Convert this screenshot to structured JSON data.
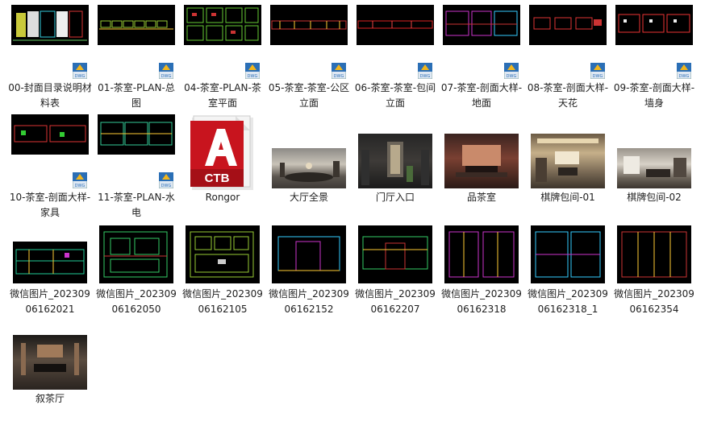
{
  "files": [
    {
      "name": "00-封面目录说明材料表",
      "type": "dwg"
    },
    {
      "name": "01-茶室-PLAN-总图",
      "type": "dwg"
    },
    {
      "name": "04-茶室-PLAN-茶室平面",
      "type": "dwg"
    },
    {
      "name": "05-茶室-茶室-公区立面",
      "type": "dwg"
    },
    {
      "name": "06-茶室-茶室-包间立面",
      "type": "dwg"
    },
    {
      "name": "07-茶室-剖面大样-地面",
      "type": "dwg"
    },
    {
      "name": "08-茶室-剖面大样-天花",
      "type": "dwg"
    },
    {
      "name": "09-茶室-剖面大样-墙身",
      "type": "dwg"
    },
    {
      "name": "10-茶室-剖面大样-家具",
      "type": "dwg"
    },
    {
      "name": "11-茶室-PLAN-水电",
      "type": "dwg"
    },
    {
      "name": "Rongor",
      "type": "ctb",
      "icon_text": "CTB"
    },
    {
      "name": "大厅全景",
      "type": "image"
    },
    {
      "name": "门厅入口",
      "type": "image"
    },
    {
      "name": "品茶室",
      "type": "image"
    },
    {
      "name": "棋牌包间-01",
      "type": "image"
    },
    {
      "name": "棋牌包间-02",
      "type": "image"
    },
    {
      "name": "微信图片_20230906162021",
      "type": "image"
    },
    {
      "name": "微信图片_20230906162050",
      "type": "image"
    },
    {
      "name": "微信图片_20230906162105",
      "type": "image"
    },
    {
      "name": "微信图片_20230906162152",
      "type": "image"
    },
    {
      "name": "微信图片_20230906162207",
      "type": "image"
    },
    {
      "name": "微信图片_20230906162318",
      "type": "image"
    },
    {
      "name": "微信图片_20230906162318_1",
      "type": "image"
    },
    {
      "name": "微信图片_20230906162354",
      "type": "image"
    },
    {
      "name": "叙茶厅",
      "type": "image"
    }
  ],
  "badge_text": "DWG",
  "colors": {
    "cad_bg": "#000000",
    "ctb_red": "#c8141e",
    "badge_blue": "#2b6fb6",
    "badge_yellow": "#f2b61c"
  }
}
